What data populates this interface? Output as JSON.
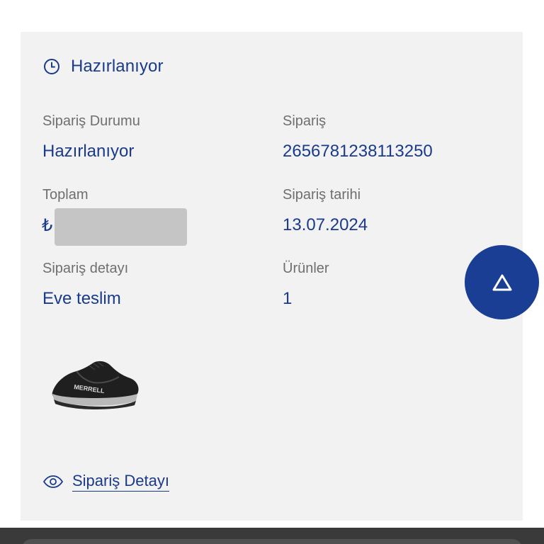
{
  "order": {
    "status_header": "Hazırlanıyor",
    "status_label": "Sipariş Durumu",
    "status_value": "Hazırlanıyor",
    "order_label": "Sipariş",
    "order_number": "2656781238113250",
    "total_label": "Toplam",
    "total_currency": "₺",
    "date_label": "Sipariş tarihi",
    "date_value": "13.07.2024",
    "delivery_label": "Sipariş detayı",
    "delivery_value": "Eve teslim",
    "items_label": "Ürünler",
    "items_value": "1",
    "detail_link": "Sipariş Detayı",
    "product_logo_text": "MERRELL"
  },
  "icons": {
    "status": "clock-icon",
    "detail": "eye-icon",
    "scroll": "triangle-up-icon"
  },
  "colors": {
    "accent": "#1a3a8a",
    "label": "#6f6f6f",
    "card_bg": "#f2f2f2",
    "fab_bg": "#1a3e93",
    "masked": "#c5c5c5"
  }
}
